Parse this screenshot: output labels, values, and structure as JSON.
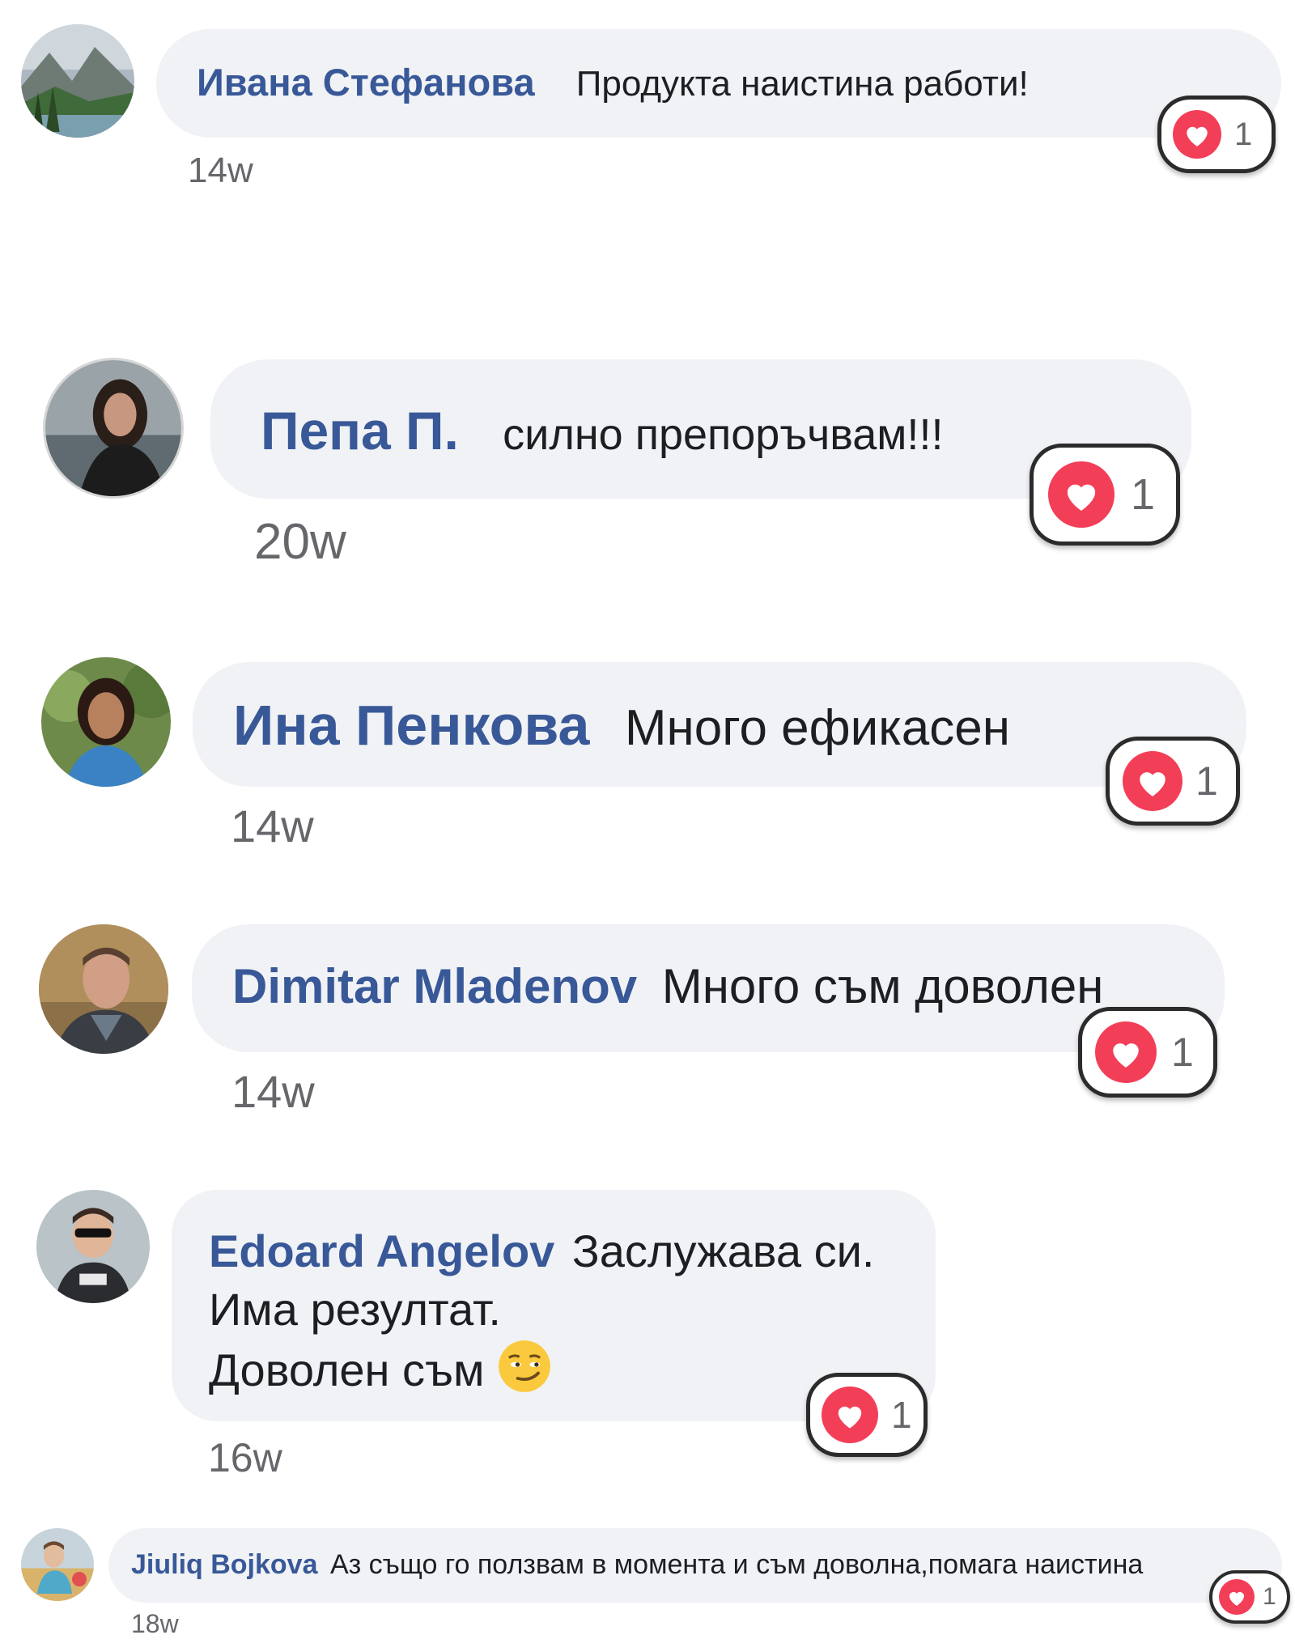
{
  "colors": {
    "name": "#385898",
    "text": "#1c1e21",
    "time": "#65676b",
    "bubble": "#f0f2f5",
    "heart": "#f33e58"
  },
  "comments": [
    {
      "author": "Ивана Стефанова",
      "text": "Продукта наистина работи!",
      "time": "14w",
      "reaction": "heart-icon",
      "count": "1",
      "avatar": "landscape-photo"
    },
    {
      "author": "Пепа П.",
      "text": "силно препоръчвам!!!",
      "time": "20w",
      "reaction": "heart-icon",
      "count": "1",
      "avatar": "woman-photo"
    },
    {
      "author": "Ина Пенкова",
      "text": "Много ефикасен",
      "time": "14w",
      "reaction": "heart-icon",
      "count": "1",
      "avatar": "woman-photo"
    },
    {
      "author": "Dimitar Mladenov",
      "text": "Много съм доволен",
      "time": "14w",
      "reaction": "heart-icon",
      "count": "1",
      "avatar": "man-photo"
    },
    {
      "author": "Edoard Angelov",
      "lines": [
        "Заслужава си.",
        "Има резултат.",
        "Доволен съм"
      ],
      "emoji": "smirking-face",
      "time": "16w",
      "reaction": "heart-icon",
      "count": "1",
      "avatar": "child-photo"
    },
    {
      "author": "Jiuliq Bojkova",
      "text": "Аз също го ползвам в момента и съм доволна,помага наистина",
      "time": "18w",
      "reaction": "heart-icon",
      "count": "1",
      "avatar": "child-photo"
    }
  ]
}
